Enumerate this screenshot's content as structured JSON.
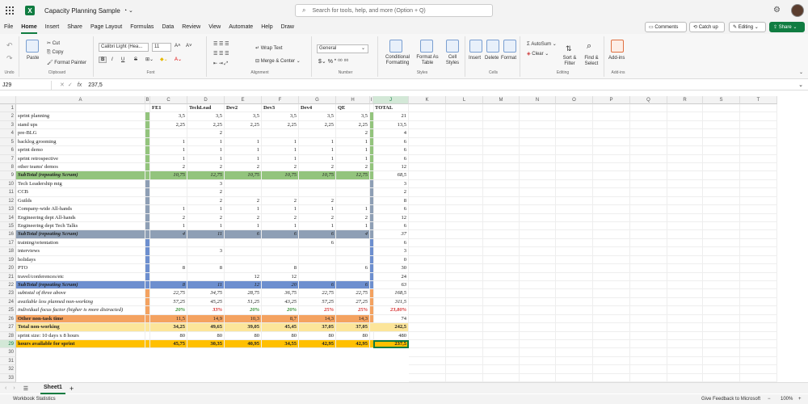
{
  "app": {
    "title": "Capacity Planning Sample",
    "search_placeholder": "Search for tools, help, and more (Option + Q)"
  },
  "menus": [
    "File",
    "Home",
    "Insert",
    "Share",
    "Page Layout",
    "Formulas",
    "Data",
    "Review",
    "View",
    "Automate",
    "Help",
    "Draw"
  ],
  "menu_active": 1,
  "right_buttons": {
    "comments": "Comments",
    "catchup": "Catch up",
    "editing": "Editing",
    "share": "Share"
  },
  "ribbon": {
    "undo_label": "Undo",
    "paste": "Paste",
    "cut": "Cut",
    "copy": "Copy",
    "format_painter": "Format Painter",
    "clipboard": "Clipboard",
    "font_name": "Calibri Light (Hea...",
    "font_size": "11",
    "font": "Font",
    "wrap_text": "Wrap Text",
    "merge_center": "Merge & Center",
    "alignment": "Alignment",
    "number_format": "General",
    "number": "Number",
    "cond_fmt": "Conditional Formatting",
    "format_as_table": "Format As Table",
    "cell_styles": "Cell Styles",
    "styles": "Styles",
    "insert": "Insert",
    "delete": "Delete",
    "format": "Format",
    "cells": "Cells",
    "autosum": "AutoSum",
    "clear": "Clear",
    "sort_filter": "Sort & Filter",
    "find_select": "Find & Select",
    "editing": "Editing",
    "addins": "Add-ins",
    "addins_grp": "Add-ins"
  },
  "formula_bar": {
    "name_box": "J29",
    "fx": "fx",
    "value": "237,5"
  },
  "columns": [
    "A",
    "B",
    "C",
    "D",
    "E",
    "F",
    "G",
    "H",
    "I",
    "J",
    "K",
    "L",
    "M",
    "N",
    "O",
    "P",
    "Q",
    "R",
    "S",
    "T"
  ],
  "rows": [
    {
      "n": "1",
      "a": "",
      "c": "FE1",
      "d": "TechLead",
      "e": "Dev2",
      "f": "Dev3",
      "g": "Dev4",
      "h": "QE",
      "j": "TOTAL",
      "style": "hdr"
    },
    {
      "n": "2",
      "a": "sprint planning",
      "c": "3,5",
      "d": "3,5",
      "e": "3,5",
      "f": "3,5",
      "g": "3,5",
      "h": "3,5",
      "j": "21"
    },
    {
      "n": "3",
      "a": "stand ups",
      "c": "2,25",
      "d": "2,25",
      "e": "2,25",
      "f": "2,25",
      "g": "2,25",
      "h": "2,25",
      "j": "13,5"
    },
    {
      "n": "4",
      "a": "pre-BLG",
      "c": "",
      "d": "2",
      "e": "",
      "f": "",
      "g": "",
      "h": "2",
      "j": "4"
    },
    {
      "n": "5",
      "a": "backlog grooming",
      "c": "1",
      "d": "1",
      "e": "1",
      "f": "1",
      "g": "1",
      "h": "1",
      "j": "6"
    },
    {
      "n": "6",
      "a": "sprint demo",
      "c": "1",
      "d": "1",
      "e": "1",
      "f": "1",
      "g": "1",
      "h": "1",
      "j": "6"
    },
    {
      "n": "7",
      "a": "sprint retrospective",
      "c": "1",
      "d": "1",
      "e": "1",
      "f": "1",
      "g": "1",
      "h": "1",
      "j": "6"
    },
    {
      "n": "8",
      "a": "other teams' demos",
      "c": "2",
      "d": "2",
      "e": "2",
      "f": "2",
      "g": "2",
      "h": "2",
      "j": "12"
    },
    {
      "n": "9",
      "a": "SubTotal (repeating Scrum)",
      "c": "10,75",
      "d": "12,75",
      "e": "10,75",
      "f": "10,75",
      "g": "10,75",
      "h": "12,75",
      "j": "68,5",
      "style": "sub-green"
    },
    {
      "n": "10",
      "a": "Tech Leadership mtg",
      "c": "",
      "d": "3",
      "e": "",
      "f": "",
      "g": "",
      "h": "",
      "j": "3"
    },
    {
      "n": "11",
      "a": "CCB",
      "c": "",
      "d": "2",
      "e": "",
      "f": "",
      "g": "",
      "h": "",
      "j": "2"
    },
    {
      "n": "12",
      "a": "Guilds",
      "c": "",
      "d": "2",
      "e": "2",
      "f": "2",
      "g": "2",
      "h": "",
      "j": "8"
    },
    {
      "n": "13",
      "a": "Company-wide All-hands",
      "c": "1",
      "d": "1",
      "e": "1",
      "f": "1",
      "g": "1",
      "h": "1",
      "j": "6"
    },
    {
      "n": "14",
      "a": "Engineering dept All-hands",
      "c": "2",
      "d": "2",
      "e": "2",
      "f": "2",
      "g": "2",
      "h": "2",
      "j": "12"
    },
    {
      "n": "15",
      "a": "Engineering dept Tech Talks",
      "c": "1",
      "d": "1",
      "e": "1",
      "f": "1",
      "g": "1",
      "h": "1",
      "j": "6"
    },
    {
      "n": "16",
      "a": "SubTotal (repeating Scrum)",
      "c": "4",
      "d": "11",
      "e": "6",
      "f": "6",
      "g": "6",
      "h": "4",
      "j": "37",
      "style": "sub-gray"
    },
    {
      "n": "17",
      "a": "training/orientation",
      "c": "",
      "d": "",
      "e": "",
      "f": "",
      "g": "6",
      "h": "",
      "j": "6"
    },
    {
      "n": "18",
      "a": "interviews",
      "c": "",
      "d": "3",
      "e": "",
      "f": "",
      "g": "",
      "h": "",
      "j": "3"
    },
    {
      "n": "19",
      "a": "holidays",
      "c": "",
      "d": "",
      "e": "",
      "f": "",
      "g": "",
      "h": "",
      "j": "0"
    },
    {
      "n": "20",
      "a": "PTO",
      "c": "8",
      "d": "8",
      "e": "",
      "f": "8",
      "g": "",
      "h": "6",
      "j": "30"
    },
    {
      "n": "21",
      "a": "travel/conferences/etc",
      "c": "",
      "d": "",
      "e": "12",
      "f": "12",
      "g": "",
      "h": "",
      "j": "24"
    },
    {
      "n": "22",
      "a": "SubTotal (repeating Scrum)",
      "c": "8",
      "d": "11",
      "e": "12",
      "f": "20",
      "g": "6",
      "h": "6",
      "j": "63",
      "style": "sub-blue"
    },
    {
      "n": "23",
      "a": "subtotal of three above",
      "c": "22,75",
      "d": "34,75",
      "e": "28,75",
      "f": "36,75",
      "g": "22,75",
      "h": "22,75",
      "j": "168,5",
      "style": "ital"
    },
    {
      "n": "24",
      "a": "available less planned non-working",
      "c": "57,25",
      "d": "45,25",
      "e": "51,25",
      "f": "43,25",
      "g": "57,25",
      "h": "27,25",
      "j": "311,5",
      "style": "ital"
    },
    {
      "n": "25",
      "a": "individual focus factor (higher is more distracted)",
      "c": "20%",
      "d": "33%",
      "e": "20%",
      "f": "20%",
      "g": "25%",
      "h": "25%",
      "j": "23,80%",
      "style": "pct"
    },
    {
      "n": "26",
      "a": "Other non-task time",
      "c": "11,5",
      "d": "14,9",
      "e": "10,3",
      "f": "8,7",
      "g": "14,3",
      "h": "14,3",
      "j": "74",
      "style": "orange"
    },
    {
      "n": "27",
      "a": "Total non-working",
      "c": "34,25",
      "d": "49,65",
      "e": "39,05",
      "f": "45,45",
      "g": "37,05",
      "h": "37,05",
      "j": "242,5",
      "style": "yellow"
    },
    {
      "n": "28",
      "a": "sprint size: 10 days x 8 hours",
      "c": "80",
      "d": "80",
      "e": "80",
      "f": "80",
      "g": "80",
      "h": "80",
      "j": "480"
    },
    {
      "n": "29",
      "a": "hours available for sprint",
      "c": "45,75",
      "d": "30,35",
      "e": "40,95",
      "f": "34,55",
      "g": "42,95",
      "h": "42,95",
      "j": "237,5",
      "style": "gold"
    },
    {
      "n": "30"
    },
    {
      "n": "31"
    },
    {
      "n": "32"
    },
    {
      "n": "33"
    }
  ],
  "colors": {
    "green": "#93c47d",
    "gray": "#8e9fb5",
    "blue": "#6d8fcf",
    "orange": "#f4a260",
    "yellow": "#fce59a",
    "gold": "#ffc000",
    "accent": "#107c41",
    "pct_green": "#2e8b2e",
    "pct_red": "#d62b2b"
  },
  "sheet_tab": "Sheet1",
  "status": {
    "left": "Workbook Statistics",
    "feedback": "Give Feedback to Microsoft",
    "zoom": "100%"
  }
}
